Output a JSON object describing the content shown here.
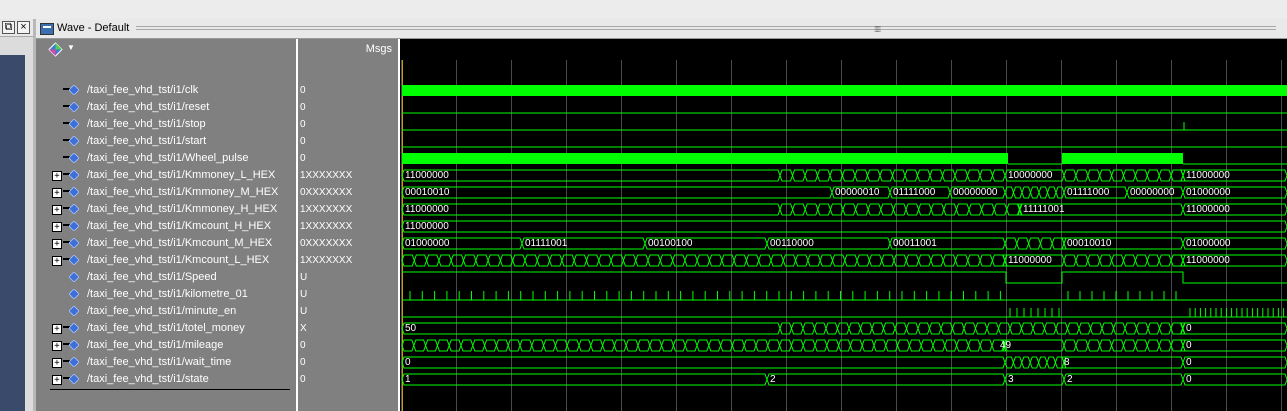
{
  "window": {
    "title": "Wave - Default"
  },
  "header": {
    "msgs_label": "Msgs"
  },
  "colors": {
    "signal": "#00ff00",
    "background": "#000000",
    "panel": "#808080",
    "cursor": "#c8a000",
    "text": "#ffffff"
  },
  "signals": [
    {
      "name": "/taxi_fee_vhd_tst/i1/clk",
      "value": "0",
      "kind": "clock",
      "expandable": false
    },
    {
      "name": "/taxi_fee_vhd_tst/i1/reset",
      "value": "0",
      "kind": "low",
      "expandable": false
    },
    {
      "name": "/taxi_fee_vhd_tst/i1/stop",
      "value": "0",
      "kind": "low_spike",
      "expandable": false
    },
    {
      "name": "/taxi_fee_vhd_tst/i1/start",
      "value": "0",
      "kind": "low",
      "expandable": false
    },
    {
      "name": "/taxi_fee_vhd_tst/i1/Wheel_pulse",
      "value": "0",
      "kind": "wheel",
      "expandable": false
    },
    {
      "name": "/taxi_fee_vhd_tst/i1/Kmmoney_L_HEX",
      "value": "1XXXXXXX",
      "kind": "bus",
      "expandable": true
    },
    {
      "name": "/taxi_fee_vhd_tst/i1/Kmmoney_M_HEX",
      "value": "0XXXXXXX",
      "kind": "bus",
      "expandable": true
    },
    {
      "name": "/taxi_fee_vhd_tst/i1/Kmmoney_H_HEX",
      "value": "1XXXXXXX",
      "kind": "bus",
      "expandable": true
    },
    {
      "name": "/taxi_fee_vhd_tst/i1/Kmcount_H_HEX",
      "value": "1XXXXXXX",
      "kind": "bus",
      "expandable": true
    },
    {
      "name": "/taxi_fee_vhd_tst/i1/Kmcount_M_HEX",
      "value": "0XXXXXXX",
      "kind": "bus",
      "expandable": true
    },
    {
      "name": "/taxi_fee_vhd_tst/i1/Kmcount_L_HEX",
      "value": "1XXXXXXX",
      "kind": "bus",
      "expandable": true
    },
    {
      "name": "/taxi_fee_vhd_tst/i1/Speed",
      "value": "U",
      "kind": "speed",
      "expandable": false
    },
    {
      "name": "/taxi_fee_vhd_tst/i1/kilometre_01",
      "value": "U",
      "kind": "pulses",
      "expandable": false
    },
    {
      "name": "/taxi_fee_vhd_tst/i1/minute_en",
      "value": "U",
      "kind": "minute",
      "expandable": false
    },
    {
      "name": "/taxi_fee_vhd_tst/i1/totel_money",
      "value": "X",
      "kind": "bus",
      "expandable": true
    },
    {
      "name": "/taxi_fee_vhd_tst/i1/mileage",
      "value": "0",
      "kind": "bus",
      "expandable": true
    },
    {
      "name": "/taxi_fee_vhd_tst/i1/wait_time",
      "value": "0",
      "kind": "bus",
      "expandable": true
    },
    {
      "name": "/taxi_fee_vhd_tst/i1/state",
      "value": "0",
      "kind": "bus",
      "expandable": true
    }
  ],
  "wave_labels": {
    "kmmoney_l": [
      "11000000",
      "10000000",
      "11000000"
    ],
    "kmmoney_m": [
      "00010010",
      "00000010",
      "01111000",
      "00000000",
      "01111000",
      "00000000",
      "01000000"
    ],
    "kmmoney_h": [
      "11000000",
      "11111001",
      "11000000"
    ],
    "kmcount_h": [
      "11000000"
    ],
    "kmcount_m": [
      "01000000",
      "01111001",
      "00100100",
      "00110000",
      "00011001",
      "00010010",
      "01000000"
    ],
    "kmcount_l": [
      "11000000",
      "11000000"
    ],
    "totel_money": [
      "50",
      "0"
    ],
    "mileage": [
      "49",
      "0"
    ],
    "wait_time": [
      "0",
      "8",
      "0"
    ],
    "state": [
      "1",
      "2",
      "3",
      "2",
      "0"
    ]
  }
}
